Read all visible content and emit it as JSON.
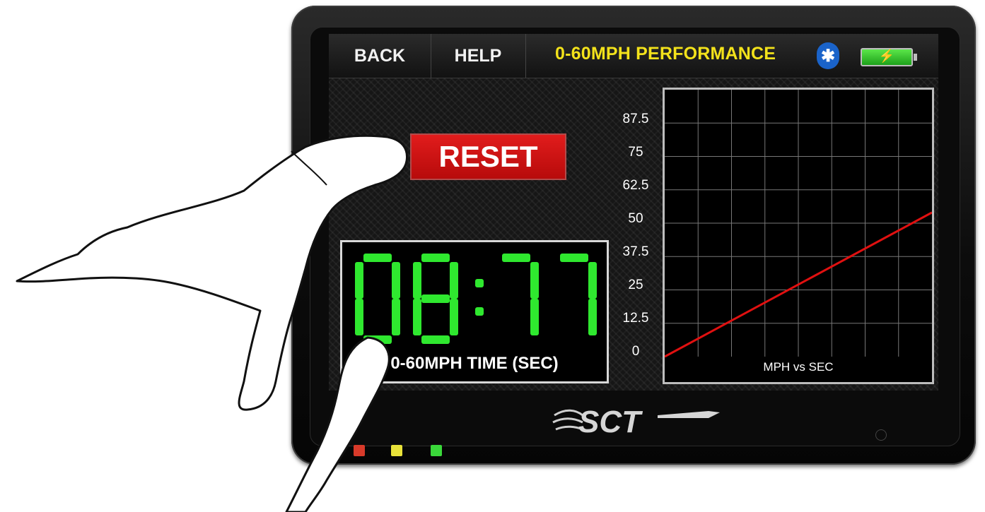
{
  "header": {
    "back_label": "BACK",
    "help_label": "HELP",
    "title": "0-60MPH PERFORMANCE",
    "bluetooth_icon": "bluetooth-icon",
    "battery_icon": "battery-charging-icon"
  },
  "reset_label": "RESET",
  "timer": {
    "value": "08:77",
    "label": "0-60MPH TIME (SEC)",
    "color": "#2fe82f"
  },
  "chart_data": {
    "type": "line",
    "x": [
      0,
      9
    ],
    "series": [
      {
        "values": [
          0,
          54
        ],
        "color": "#e01010"
      }
    ],
    "yticks": [
      "87.5",
      "75",
      "62.5",
      "50",
      "37.5",
      "25",
      "12.5",
      "0"
    ],
    "ylim": [
      0,
      100
    ],
    "xlim": [
      0,
      9
    ],
    "grid": true,
    "title": "MPH vs SEC"
  },
  "brand": "SCT",
  "leds": [
    "#d83a2a",
    "#e8e23a",
    "#3ad83a"
  ]
}
